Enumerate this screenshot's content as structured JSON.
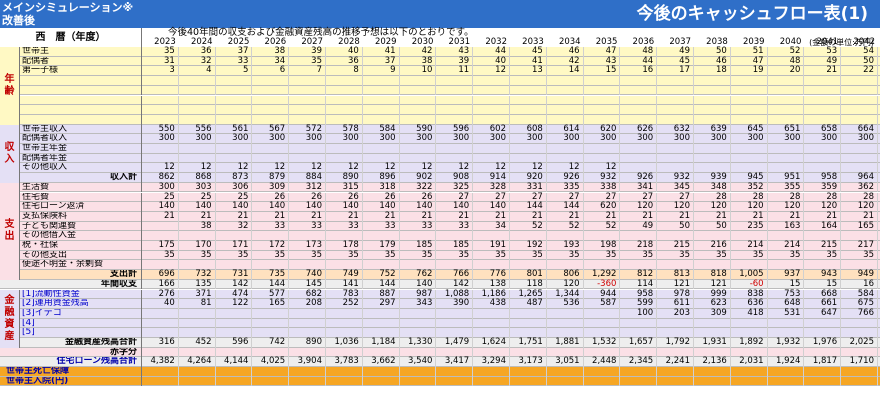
{
  "header": {
    "line1": "メインシミュレーション※",
    "line2": "改善後",
    "title": "今後のキャッシュフロー表(1)",
    "era_label": "西　暦（年度）",
    "note": "今後40年間の収支および金融資産残高の推移予想は以下のとおりです。",
    "unit": "(金額の単位:万円)"
  },
  "years": [
    "2023",
    "2024",
    "2025",
    "2026",
    "2027",
    "2028",
    "2029",
    "2030",
    "2031",
    "2032",
    "2033",
    "2034",
    "2035",
    "2036",
    "2037",
    "2038",
    "2039",
    "2040",
    "2041",
    "2042"
  ],
  "sections": [
    {
      "label": [
        "年",
        "齢"
      ]
    },
    {
      "label": [
        "収",
        "入"
      ]
    },
    {
      "label": [
        "支",
        "出"
      ]
    },
    {
      "label": [
        "金",
        "融",
        "資",
        "産"
      ]
    }
  ],
  "rows": [
    {
      "label": "世帯主",
      "values": [
        "35",
        "36",
        "37",
        "38",
        "39",
        "40",
        "41",
        "42",
        "43",
        "44",
        "45",
        "46",
        "47",
        "48",
        "49",
        "50",
        "51",
        "52",
        "53",
        "54"
      ]
    },
    {
      "label": "配偶者",
      "values": [
        "31",
        "32",
        "33",
        "34",
        "35",
        "36",
        "37",
        "38",
        "39",
        "40",
        "41",
        "42",
        "43",
        "44",
        "45",
        "46",
        "47",
        "48",
        "49",
        "50"
      ]
    },
    {
      "label": "第一子様",
      "values": [
        "3",
        "4",
        "5",
        "6",
        "7",
        "8",
        "9",
        "10",
        "11",
        "12",
        "13",
        "14",
        "15",
        "16",
        "17",
        "18",
        "19",
        "20",
        "21",
        "22"
      ]
    },
    {
      "label": "",
      "values": []
    },
    {
      "label": "",
      "values": []
    },
    {
      "label": "",
      "values": []
    },
    {
      "label": "",
      "values": []
    },
    {
      "label": "",
      "values": []
    },
    {
      "label": "世帯主収入",
      "values": [
        "550",
        "556",
        "561",
        "567",
        "572",
        "578",
        "584",
        "590",
        "596",
        "602",
        "608",
        "614",
        "620",
        "626",
        "632",
        "639",
        "645",
        "651",
        "658",
        "664"
      ]
    },
    {
      "label": "配偶者収入",
      "values": [
        "300",
        "300",
        "300",
        "300",
        "300",
        "300",
        "300",
        "300",
        "300",
        "300",
        "300",
        "300",
        "300",
        "300",
        "300",
        "300",
        "300",
        "300",
        "300",
        "300"
      ]
    },
    {
      "label": "世帯主年金",
      "values": []
    },
    {
      "label": "配偶者年金",
      "values": []
    },
    {
      "label": "その他収入",
      "values": [
        "12",
        "12",
        "12",
        "12",
        "12",
        "12",
        "12",
        "12",
        "12",
        "12",
        "12",
        "12",
        "12",
        "",
        "",
        "",
        "",
        "",
        "",
        ""
      ]
    },
    {
      "label": "収入計",
      "values": [
        "862",
        "868",
        "873",
        "879",
        "884",
        "890",
        "896",
        "902",
        "908",
        "914",
        "920",
        "926",
        "932",
        "926",
        "932",
        "939",
        "945",
        "951",
        "958",
        "964"
      ]
    },
    {
      "label": "生活費",
      "values": [
        "300",
        "303",
        "306",
        "309",
        "312",
        "315",
        "318",
        "322",
        "325",
        "328",
        "331",
        "335",
        "338",
        "341",
        "345",
        "348",
        "352",
        "355",
        "359",
        "362"
      ]
    },
    {
      "label": "住宅費",
      "values": [
        "25",
        "25",
        "25",
        "26",
        "26",
        "26",
        "26",
        "26",
        "27",
        "27",
        "27",
        "27",
        "27",
        "27",
        "27",
        "28",
        "28",
        "28",
        "28",
        "28"
      ]
    },
    {
      "label": "住宅ローン返済",
      "values": [
        "140",
        "140",
        "140",
        "140",
        "140",
        "140",
        "140",
        "140",
        "140",
        "140",
        "144",
        "144",
        "620",
        "120",
        "120",
        "120",
        "120",
        "120",
        "120",
        "120"
      ]
    },
    {
      "label": "支払保険料",
      "values": [
        "21",
        "21",
        "21",
        "21",
        "21",
        "21",
        "21",
        "21",
        "21",
        "21",
        "21",
        "21",
        "21",
        "21",
        "21",
        "21",
        "21",
        "21",
        "21",
        "21"
      ]
    },
    {
      "label": "子ども関連費",
      "values": [
        "",
        "38",
        "32",
        "33",
        "33",
        "33",
        "33",
        "33",
        "33",
        "34",
        "52",
        "52",
        "52",
        "49",
        "50",
        "50",
        "235",
        "163",
        "164",
        "165"
      ]
    },
    {
      "label": "その他借入金",
      "values": []
    },
    {
      "label": "税・社保",
      "values": [
        "175",
        "170",
        "171",
        "172",
        "173",
        "178",
        "179",
        "185",
        "185",
        "191",
        "192",
        "193",
        "198",
        "218",
        "215",
        "216",
        "214",
        "214",
        "215",
        "217"
      ]
    },
    {
      "label": "その他支出",
      "values": [
        "35",
        "35",
        "35",
        "35",
        "35",
        "35",
        "35",
        "35",
        "35",
        "35",
        "35",
        "35",
        "35",
        "35",
        "35",
        "35",
        "35",
        "35",
        "35",
        "35"
      ]
    },
    {
      "label": "使途不明金・余剰費",
      "values": []
    },
    {
      "label": "支出計",
      "values": [
        "696",
        "732",
        "731",
        "735",
        "740",
        "749",
        "752",
        "762",
        "766",
        "776",
        "801",
        "806",
        "1,292",
        "812",
        "813",
        "818",
        "1,005",
        "937",
        "943",
        "949"
      ]
    },
    {
      "label": "年間収支",
      "values": [
        "166",
        "135",
        "142",
        "144",
        "145",
        "141",
        "144",
        "140",
        "142",
        "138",
        "118",
        "120",
        "-360",
        "114",
        "121",
        "121",
        "-60",
        "15",
        "15",
        "16"
      ]
    },
    {
      "label": "[1]流動性資金",
      "values": [
        "276",
        "371",
        "474",
        "577",
        "682",
        "783",
        "887",
        "987",
        "1,088",
        "1,186",
        "1,265",
        "1,344",
        "944",
        "958",
        "978",
        "999",
        "838",
        "753",
        "668",
        "584"
      ]
    },
    {
      "label": "[2]運用資金残高",
      "values": [
        "40",
        "81",
        "122",
        "165",
        "208",
        "252",
        "297",
        "343",
        "390",
        "438",
        "487",
        "536",
        "587",
        "599",
        "611",
        "623",
        "636",
        "648",
        "661",
        "675"
      ]
    },
    {
      "label": "[3]イデコ",
      "values": [
        "",
        "",
        "",
        "",
        "",
        "",
        "",
        "",
        "",
        "",
        "",
        "",
        "",
        "100",
        "203",
        "309",
        "418",
        "531",
        "647",
        "766"
      ]
    },
    {
      "label": "[4]",
      "values": []
    },
    {
      "label": "[5]",
      "values": []
    },
    {
      "label": "金融資産残高合計",
      "values": [
        "316",
        "452",
        "596",
        "742",
        "890",
        "1,036",
        "1,184",
        "1,330",
        "1,479",
        "1,624",
        "1,751",
        "1,881",
        "1,532",
        "1,657",
        "1,792",
        "1,931",
        "1,892",
        "1,932",
        "1,976",
        "2,025"
      ]
    },
    {
      "label": "赤字分",
      "values": []
    },
    {
      "label": "住宅ローン残高合計",
      "values": [
        "4,382",
        "4,264",
        "4,144",
        "4,025",
        "3,904",
        "3,783",
        "3,662",
        "3,540",
        "3,417",
        "3,294",
        "3,173",
        "3,051",
        "2,448",
        "2,345",
        "2,241",
        "2,136",
        "2,031",
        "1,924",
        "1,817",
        "1,710"
      ]
    },
    {
      "label": "世帯主死亡保障",
      "values": []
    },
    {
      "label": "世帯主入院(円)",
      "values": []
    }
  ]
}
